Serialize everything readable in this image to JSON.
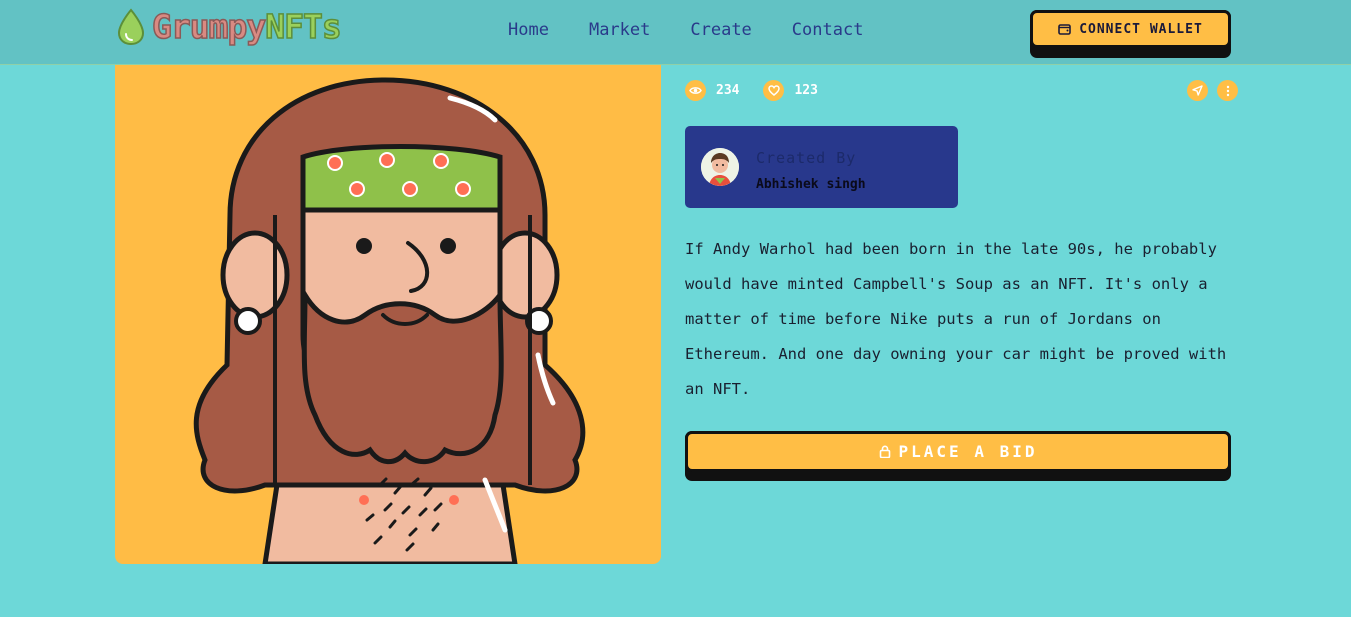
{
  "brand": {
    "name_part1": "Grumpy",
    "name_part2": "NFTs"
  },
  "nav": {
    "items": [
      "Home",
      "Market",
      "Create",
      "Contact"
    ]
  },
  "wallet_button": {
    "label": "CONNECT WALLET"
  },
  "stats": {
    "views": "234",
    "likes": "123"
  },
  "creator": {
    "label": "Created By",
    "name": "Abhishek singh"
  },
  "description": "If Andy Warhol had been born in the late 90s, he probably would have minted Campbell's Soup as an NFT. It's only a matter of time before Nike puts a run of Jordans on Ethereum. And one day owning your car might be proved with an NFT.",
  "bid_button": {
    "label": "PLACE A BID"
  },
  "colors": {
    "background": "#6dd8d8",
    "navbar": "#62c2c4",
    "accent": "#ffbe45",
    "creator_card": "#28388c",
    "nav_text": "#2a3a8a"
  },
  "icons": {
    "logo": "droplet-icon",
    "wallet": "wallet-icon",
    "views": "eye-icon",
    "likes": "heart-icon",
    "share": "send-icon",
    "more": "more-vertical-icon",
    "bid": "lock-icon"
  }
}
